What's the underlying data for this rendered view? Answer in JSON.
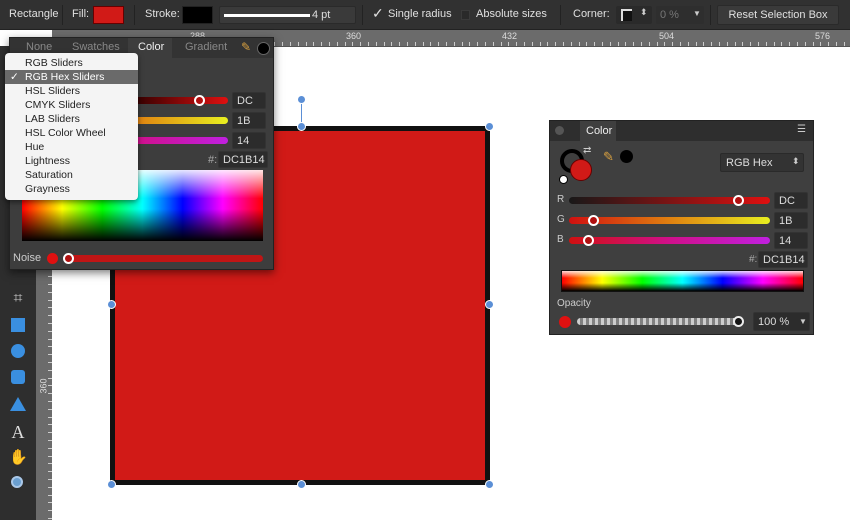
{
  "toolbar": {
    "tool_name": "Rectangle",
    "fill_label": "Fill:",
    "fill_color": "#d11a17",
    "stroke_label": "Stroke:",
    "stroke_color": "#000000",
    "stroke_width": "4 pt",
    "single_radius": "Single radius",
    "absolute_sizes": "Absolute sizes",
    "corner_label": "Corner:",
    "corner_value": "0 %",
    "reset_button": "Reset Selection Box"
  },
  "ruler": {
    "h_labels": [
      "288",
      "360",
      "432",
      "504",
      "576"
    ],
    "v_labels": [
      "360"
    ]
  },
  "fill_popup": {
    "tabs": [
      "None",
      "Swatches",
      "Color",
      "Gradient"
    ],
    "active_tab": "Color",
    "values": {
      "r": "DC",
      "g": "1B",
      "b": "14"
    },
    "hex_label": "#:",
    "hex": "DC1B14",
    "noise_label": "Noise"
  },
  "mode_menu": {
    "items": [
      "RGB Sliders",
      "RGB Hex Sliders",
      "HSL Sliders",
      "CMYK Sliders",
      "LAB Sliders",
      "HSL Color Wheel",
      "Hue",
      "Lightness",
      "Saturation",
      "Grayness"
    ],
    "checked_index": 1,
    "check": "✓"
  },
  "color_panel": {
    "title": "Color",
    "mode": "RGB Hex",
    "labels": {
      "r": "R",
      "g": "G",
      "b": "B"
    },
    "values": {
      "r": "DC",
      "g": "1B",
      "b": "14"
    },
    "hex_label": "#:",
    "hex": "DC1B14",
    "opacity_label": "Opacity",
    "opacity": "100 %"
  },
  "colors": {
    "fill": "#d11a17",
    "accent": "#5b8fd6"
  }
}
